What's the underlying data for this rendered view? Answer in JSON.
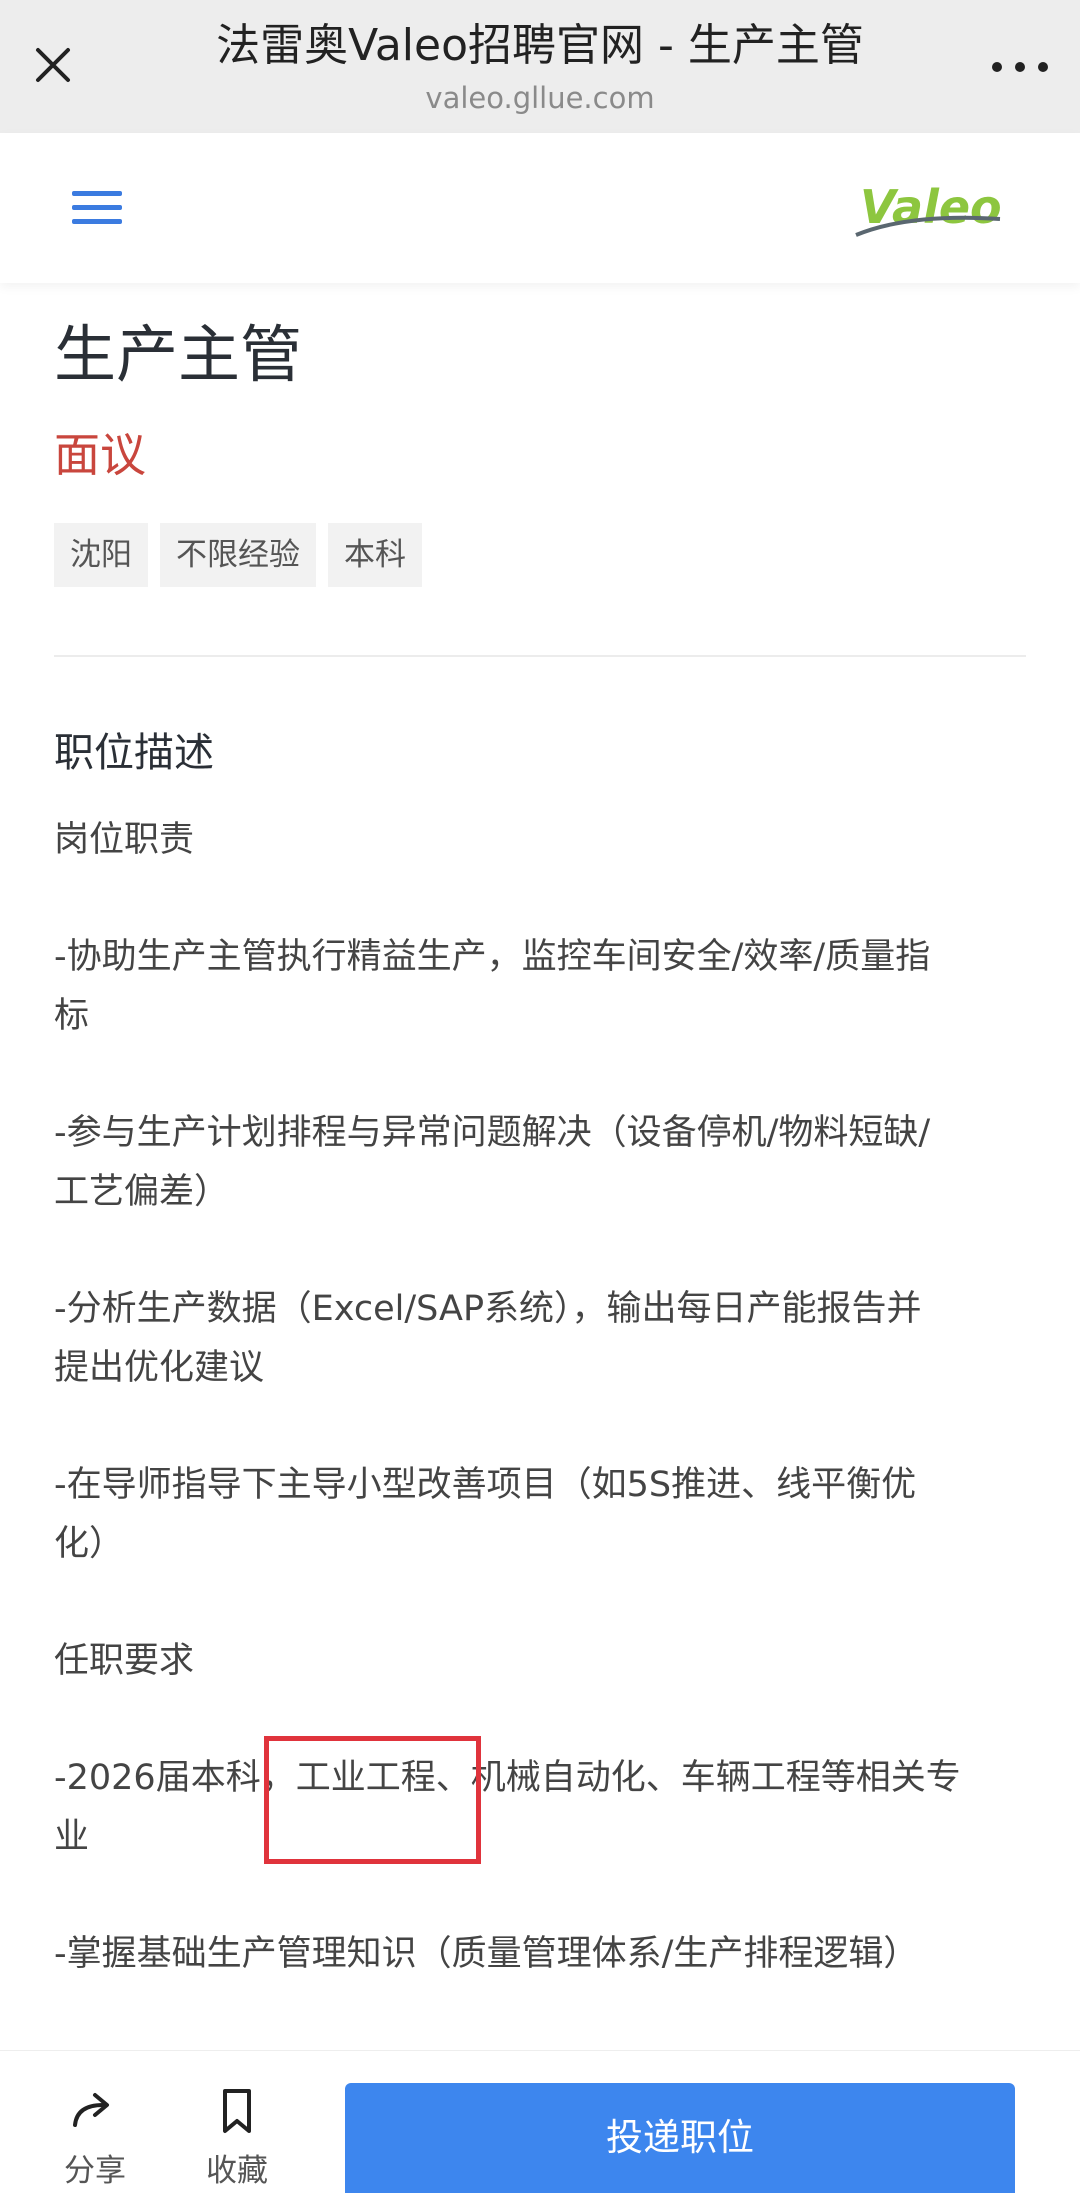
{
  "browser": {
    "title": "法雷奥Valeo招聘官网 - 生产主管",
    "url": "valeo.gllue.com"
  },
  "header": {
    "logo_text": "Valeo",
    "brand_color": "#8dc63f"
  },
  "job": {
    "title": "生产主管",
    "salary": "面议",
    "tags": [
      "沈阳",
      "不限经验",
      "本科"
    ]
  },
  "description": {
    "section_title": "职位描述",
    "lines": [
      "岗位职责",
      "-协助生产主管执行精益生产，监控车间安全/效率/质量指\n标",
      "-参与生产计划排程与异常问题解决（设备停机/物料短缺/\n工艺偏差）",
      "-分析生产数据（Excel/SAP系统），输出每日产能报告并\n提出优化建议",
      "-在导师指导下主导小型改善项目（如5S推进、线平衡优\n化）",
      "任职要求",
      "-2026届本科，工业工程、机械自动化、车辆工程等相关专\n业",
      "-掌握基础生产管理知识（质量管理体系/生产排程逻辑）"
    ]
  },
  "bottom_bar": {
    "share_label": "分享",
    "favorite_label": "收藏",
    "apply_label": "投递职位"
  }
}
